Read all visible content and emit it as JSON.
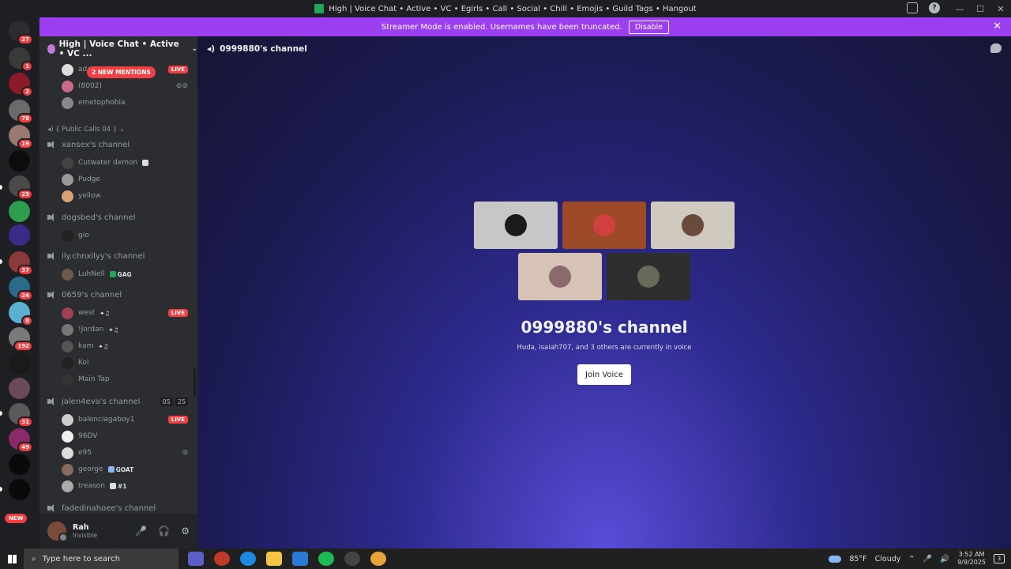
{
  "window": {
    "title": "High | Voice Chat • Active • VC • Egirls • Call • Social • Chill • Emojis • Guild Tags • Hangout",
    "minimize": "—",
    "maximize": "☐",
    "close": "✕",
    "help": "?"
  },
  "banner": {
    "text": "Streamer Mode is enabled. Usernames have been truncated.",
    "disable_label": "Disable",
    "close": "✕"
  },
  "guild_badges": [
    "27",
    "1",
    "2",
    "78",
    "19",
    "23",
    "37",
    "24",
    "8",
    "192",
    "31",
    "49"
  ],
  "new_label": "NEW",
  "server": {
    "name": "High | Voice Chat • Active • VC ...",
    "chevron": "⌄",
    "mentions": "2 NEW MENTIONS"
  },
  "sidebar": {
    "top_users": [
      {
        "name": "ada",
        "live": "LIVE"
      },
      {
        "name": "(8002)"
      },
      {
        "name": "emetophobia"
      }
    ],
    "category": "{ Public Calls 04 }",
    "category_chev": "⌄",
    "channels": [
      {
        "name": "xansex's channel",
        "users": [
          "Cutwater demon",
          "Pudge",
          "yellow"
        ]
      },
      {
        "name": "dogsbed's channel",
        "users": [
          "gio"
        ]
      },
      {
        "name": "ily.chnxllyy's channel",
        "users": [
          "LuhNell"
        ]
      },
      {
        "name": "0659's channel",
        "users": [
          "west",
          "!Jordan",
          "kam",
          "Koi",
          "Main Tap"
        ]
      },
      {
        "name": "jalen4eva's channel",
        "users": [
          "balenciagaboy1",
          "96DV",
          "e95",
          "george",
          "treason"
        ],
        "counts": [
          "05",
          "25"
        ]
      },
      {
        "name": "fadedinahoee's channel",
        "users": []
      }
    ],
    "tags": {
      "luhnell": "GAG",
      "george": "GOAT",
      "treason": "#1"
    },
    "live_label": "LIVE"
  },
  "user_panel": {
    "name": "Rah",
    "status": "Invisible",
    "mic": "🎤",
    "headset": "🎧",
    "settings": "⚙"
  },
  "main": {
    "header_title": "0999880's channel",
    "vc_title": "0999880's channel",
    "vc_subtitle": "Huda, isaiah707, and 3 others are currently in voice",
    "join_label": "Join Voice"
  },
  "taskbar": {
    "search_placeholder": "Type here to search",
    "weather_temp": "85°F",
    "weather_cond": "Cloudy",
    "time": "3:52 AM",
    "date": "9/9/2025",
    "notif_count": "3",
    "tray_up": "⌃"
  },
  "colors": {
    "accent": "#9b3ff0",
    "live": "#f23f43",
    "sidebar": "#2b2d31"
  }
}
